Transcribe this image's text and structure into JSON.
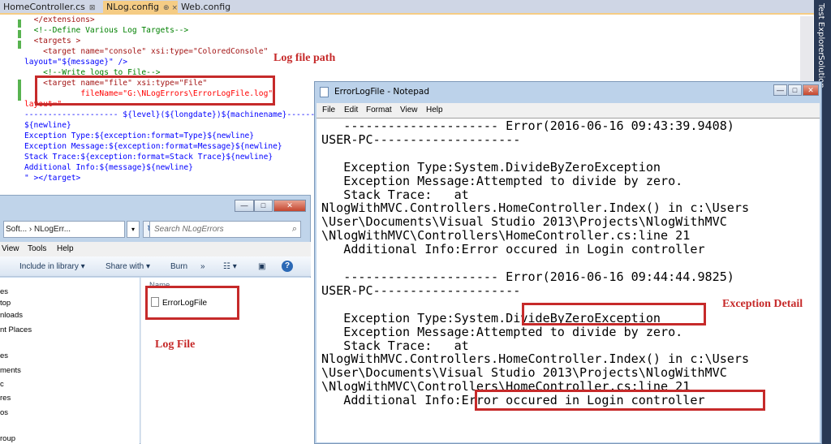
{
  "editor": {
    "tabs": [
      {
        "label": "HomeController.cs",
        "close": "⊠"
      },
      {
        "label": "NLog.config",
        "close": "⊕ ×"
      },
      {
        "label": "Web.config",
        "close": ""
      }
    ],
    "code_lines": [
      [
        "</extensions>"
      ],
      [
        "<!--Define Various Log Targets-->"
      ],
      [
        "<targets >"
      ],
      [
        "<target name=\"console\" xsi:type=\"ColoredConsole\""
      ],
      [
        "layout=\"${message}\" />"
      ],
      [
        "<!--Write logs to File-->"
      ],
      [
        "<target name=\"file\" xsi:type=\"File\""
      ],
      [
        "fileName=\"G:\\NLogErrors\\ErrorLogFile.log\""
      ],
      [
        "layout=\""
      ],
      [
        "-------------------- ${level}(${longdate})${machinename}-------------------"
      ],
      [
        "${newline}"
      ],
      [
        "Exception Type:${exception:format=Type}${newline}"
      ],
      [
        "Exception Message:${exception:format=Message}${newline}"
      ],
      [
        "Stack Trace:${exception:format=Stack Trace}${newline}"
      ],
      [
        "Additional Info:${message}${newline}"
      ],
      [
        "\" ></target>"
      ]
    ],
    "side_labels": [
      "Test Explorer",
      "Solution"
    ]
  },
  "explorer": {
    "address": "Soft... › NLogErr...",
    "search_placeholder": "Search NLogErrors",
    "menu": [
      "View",
      "Tools",
      "Help"
    ],
    "toolbar": [
      "Include in library ▾",
      "Share with ▾",
      "Burn",
      "»"
    ],
    "nav_items": [
      "es",
      "top",
      "nloads",
      "nt Places",
      "es",
      "ments",
      "c",
      "res",
      "os",
      "roup"
    ],
    "column_header": "Name",
    "file_name": "ErrorLogFile"
  },
  "notepad": {
    "title": "ErrorLogFile - Notepad",
    "menu": [
      "File",
      "Edit",
      "Format",
      "View",
      "Help"
    ],
    "lines": [
      "   --------------------- Error(2016-06-16 09:43:39.9408)",
      "USER-PC--------------------",
      "",
      "   Exception Type:System.DivideByZeroException",
      "   Exception Message:Attempted to divide by zero.",
      "   Stack Trace:   at",
      "NlogWithMVC.Controllers.HomeController.Index() in c:\\Users",
      "\\User\\Documents\\Visual Studio 2013\\Projects\\NlogWithMVC",
      "\\NlogWithMVC\\Controllers\\HomeController.cs:line 21",
      "   Additional Info:Error occured in Login controller",
      "",
      "   --------------------- Error(2016-06-16 09:44:44.9825)",
      "USER-PC--------------------",
      "",
      "   Exception Type:System.DivideByZeroException",
      "   Exception Message:Attempted to divide by zero.",
      "   Stack Trace:   at",
      "NlogWithMVC.Controllers.HomeController.Index() in c:\\Users",
      "\\User\\Documents\\Visual Studio 2013\\Projects\\NlogWithMVC",
      "\\NlogWithMVC\\Controllers\\HomeController.cs:line 21",
      "   Additional Info:Error occured in Login controller"
    ]
  },
  "annotations": {
    "log_file_path": "Log file path",
    "log_file": "Log File",
    "exception_detail": "Exception Detail"
  },
  "colors": {
    "annotation": "#c62a2a",
    "vs_tab_active": "#f5cc84",
    "xml_tag": "#a31515",
    "xml_attr": "#ff0000",
    "xml_value": "#0000ff",
    "xml_comment": "#008000"
  }
}
